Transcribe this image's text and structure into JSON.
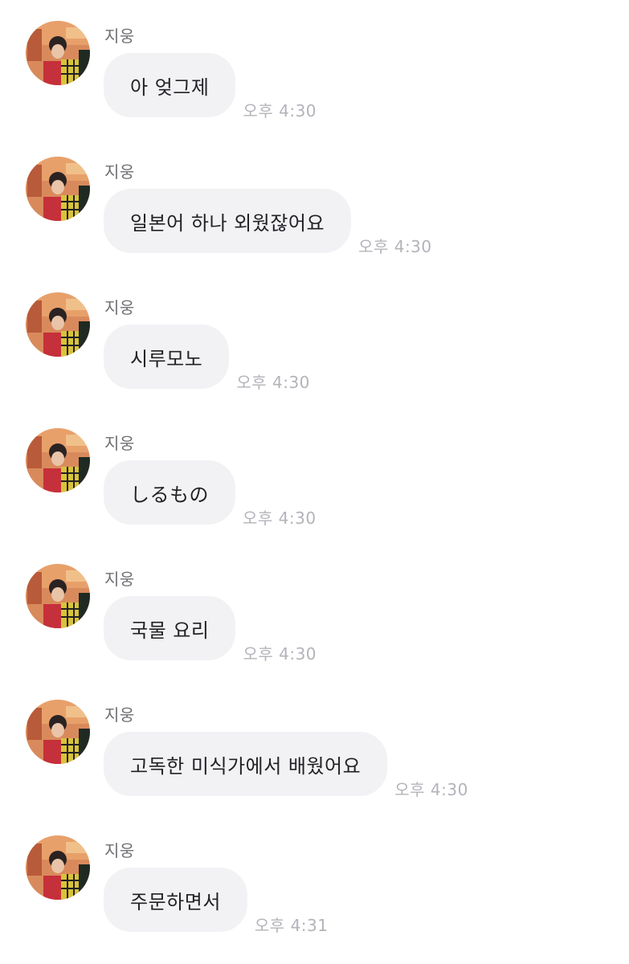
{
  "messages": [
    {
      "sender": "지웅",
      "text": "아 엊그제",
      "time": "오후 4:30"
    },
    {
      "sender": "지웅",
      "text": "일본어 하나 외웠잖어요",
      "time": "오후 4:30"
    },
    {
      "sender": "지웅",
      "text": "시루모노",
      "time": "오후 4:30"
    },
    {
      "sender": "지웅",
      "text": "しるもの",
      "time": "오후 4:30"
    },
    {
      "sender": "지웅",
      "text": "국물 요리",
      "time": "오후 4:30"
    },
    {
      "sender": "지웅",
      "text": "고독한 미식가에서 배웠어요",
      "time": "오후 4:30"
    },
    {
      "sender": "지웅",
      "text": "주문하면서",
      "time": "오후 4:31"
    }
  ],
  "colors": {
    "bubble": "#f2f2f5",
    "message_text": "#222226",
    "sender_text": "#6f6f73",
    "time_text": "#b3b3ba"
  },
  "icons": {
    "avatar": "profile-photo"
  }
}
